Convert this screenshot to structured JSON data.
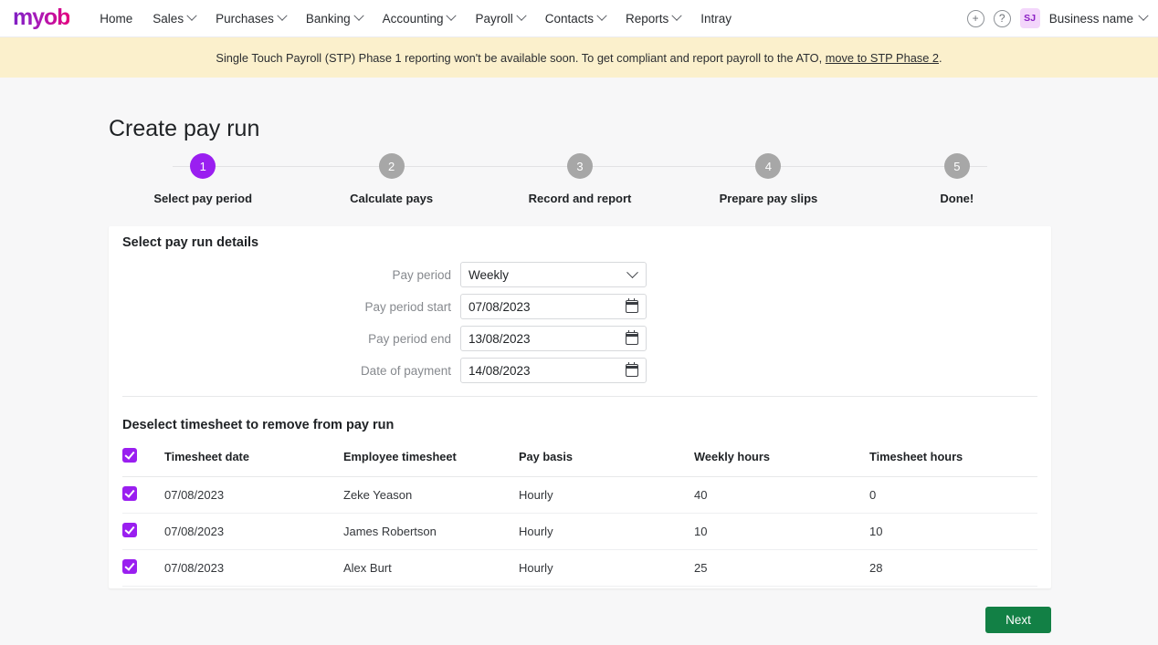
{
  "nav": {
    "logo": "myob",
    "items": [
      {
        "label": "Home",
        "caret": false
      },
      {
        "label": "Sales",
        "caret": true
      },
      {
        "label": "Purchases",
        "caret": true
      },
      {
        "label": "Banking",
        "caret": true
      },
      {
        "label": "Accounting",
        "caret": true
      },
      {
        "label": "Payroll",
        "caret": true
      },
      {
        "label": "Contacts",
        "caret": true
      },
      {
        "label": "Reports",
        "caret": true
      },
      {
        "label": "Intray",
        "caret": false
      }
    ],
    "add_icon": "plus-circle-icon",
    "help_icon": "help-circle-icon",
    "avatar_initials": "SJ",
    "business_name": "Business name"
  },
  "banner": {
    "text_before": "Single Touch Payroll (STP) Phase 1 reporting won't be available soon. To get compliant and report payroll to the ATO,",
    "link": "move to STP Phase 2",
    "text_after": ".",
    "background": "#fbf0cc"
  },
  "page": {
    "title": "Create pay run"
  },
  "stepper": {
    "active_index": 1,
    "active_color": "#9a1ff0",
    "inactive_color": "#a7a7a7",
    "steps": [
      {
        "number": "1",
        "label": "Select pay period"
      },
      {
        "number": "2",
        "label": "Calculate pays"
      },
      {
        "number": "3",
        "label": "Record and report"
      },
      {
        "number": "4",
        "label": "Prepare pay slips"
      },
      {
        "number": "5",
        "label": "Done!"
      }
    ]
  },
  "details": {
    "section_title": "Select pay run details",
    "fields": [
      {
        "label": "Pay period",
        "value": "Weekly",
        "type": "select",
        "icon": "chevron-down-icon"
      },
      {
        "label": "Pay period start",
        "value": "07/08/2023",
        "type": "date",
        "icon": "calendar-icon"
      },
      {
        "label": "Pay period end",
        "value": "13/08/2023",
        "type": "date",
        "icon": "calendar-icon"
      },
      {
        "label": "Date of payment",
        "value": "14/08/2023",
        "type": "date",
        "icon": "calendar-icon"
      }
    ],
    "pay_period_options": [
      "Weekly"
    ]
  },
  "timesheets": {
    "section_title": "Deselect timesheet to remove from pay run",
    "select_all_checked": true,
    "columns": [
      "Timesheet date",
      "Employee timesheet",
      "Pay basis",
      "Weekly hours",
      "Timesheet hours"
    ],
    "rows": [
      {
        "checked": true,
        "date": "07/08/2023",
        "employee": "Zeke Yeason",
        "basis": "Hourly",
        "weekly_hours": "40",
        "timesheet_hours": "0"
      },
      {
        "checked": true,
        "date": "07/08/2023",
        "employee": "James Robertson",
        "basis": "Hourly",
        "weekly_hours": "10",
        "timesheet_hours": "10"
      },
      {
        "checked": true,
        "date": "07/08/2023",
        "employee": "Alex Burt",
        "basis": "Hourly",
        "weekly_hours": "25",
        "timesheet_hours": "28"
      }
    ],
    "checkbox_color": "#9a1ff0"
  },
  "footer": {
    "next_label": "Next",
    "next_color": "#128045"
  }
}
